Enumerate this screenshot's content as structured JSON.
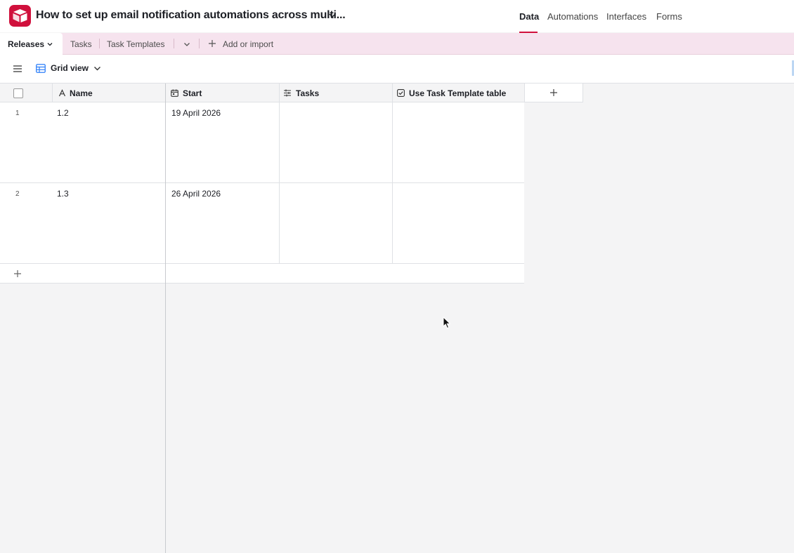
{
  "header": {
    "base_title": "How to set up email notification automations across multi...",
    "nav": [
      "Data",
      "Automations",
      "Interfaces",
      "Forms"
    ],
    "active_nav": "Data",
    "brand_color": "#d0103c"
  },
  "tabs": {
    "active": "Releases",
    "items": [
      "Tasks",
      "Task Templates"
    ],
    "add_import": "Add or import"
  },
  "view": {
    "name": "Grid view"
  },
  "grid": {
    "columns": [
      {
        "label": "Name",
        "icon": "text-field-icon"
      },
      {
        "label": "Start",
        "icon": "calendar-icon"
      },
      {
        "label": "Tasks",
        "icon": "linked-record-icon"
      },
      {
        "label": "Use Task Template table",
        "icon": "checkbox-icon"
      }
    ],
    "rows": [
      {
        "num": "1",
        "name": "1.2",
        "start": "19 April 2026",
        "tasks": "",
        "use_template": ""
      },
      {
        "num": "2",
        "name": "1.3",
        "start": "26 April 2026",
        "tasks": "",
        "use_template": ""
      }
    ]
  }
}
